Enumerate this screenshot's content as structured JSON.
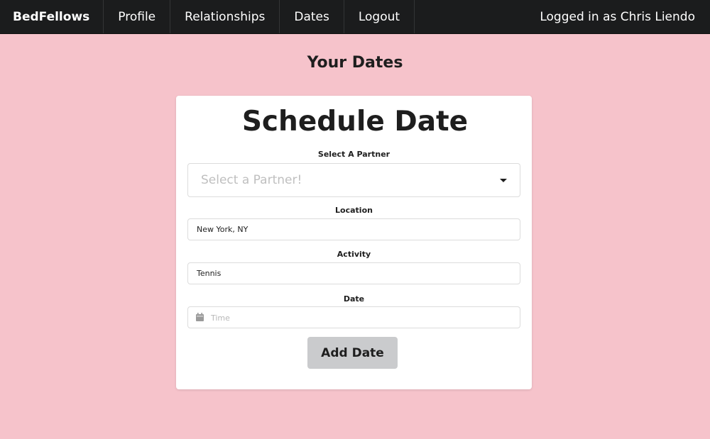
{
  "navbar": {
    "brand": "BedFellows",
    "items": [
      {
        "label": "Profile"
      },
      {
        "label": "Relationships"
      },
      {
        "label": "Dates"
      },
      {
        "label": "Logout"
      }
    ],
    "user_status": "Logged in as Chris Liendo"
  },
  "page": {
    "heading": "Your Dates"
  },
  "form": {
    "title": "Schedule Date",
    "partner": {
      "label": "Select A Partner",
      "placeholder": "Select a Partner!"
    },
    "location": {
      "label": "Location",
      "value": "New York, NY"
    },
    "activity": {
      "label": "Activity",
      "value": "Tennis"
    },
    "date": {
      "label": "Date",
      "placeholder": "Time",
      "icon": "calendar-icon"
    },
    "submit_label": "Add Date"
  },
  "colors": {
    "background": "#f6c3cb",
    "navbar": "#1b1c1d",
    "button": "#cacbcd"
  }
}
